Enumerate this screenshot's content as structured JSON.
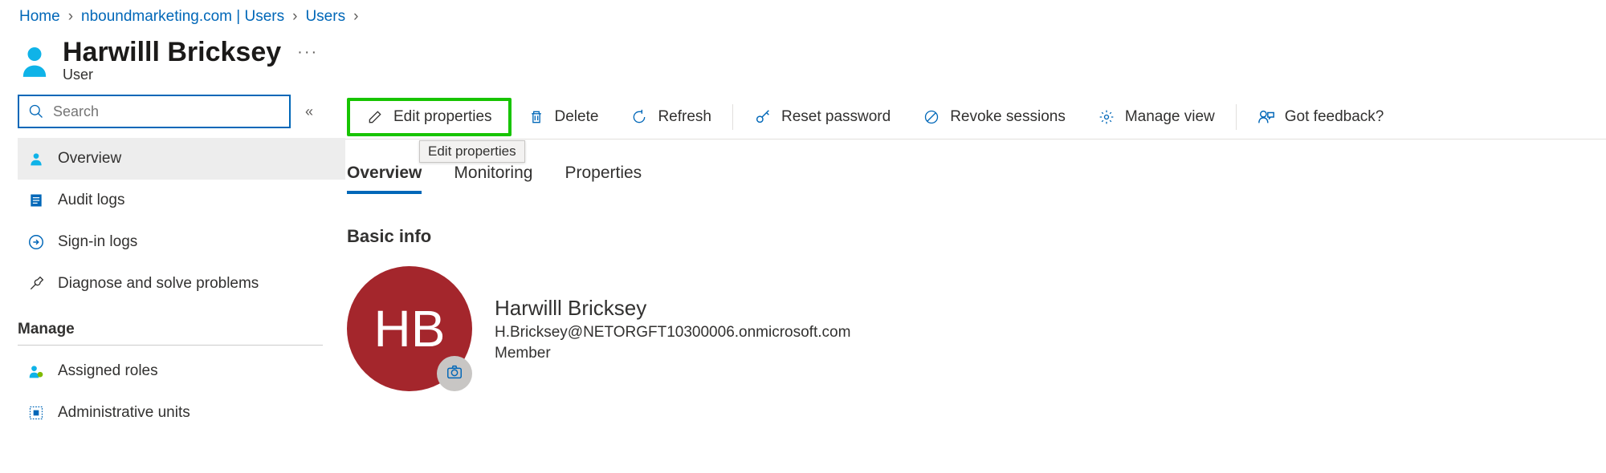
{
  "breadcrumb": {
    "items": [
      {
        "label": "Home"
      },
      {
        "label": "nboundmarketing.com | Users"
      },
      {
        "label": "Users"
      }
    ]
  },
  "header": {
    "title": "Harwilll Bricksey",
    "subtitle": "User",
    "more": "···"
  },
  "search": {
    "placeholder": "Search"
  },
  "collapse_glyph": "«",
  "sidebar": {
    "items": [
      {
        "label": "Overview"
      },
      {
        "label": "Audit logs"
      },
      {
        "label": "Sign-in logs"
      },
      {
        "label": "Diagnose and solve problems"
      }
    ],
    "manage_header": "Manage",
    "manage_items": [
      {
        "label": "Assigned roles"
      },
      {
        "label": "Administrative units"
      }
    ]
  },
  "toolbar": {
    "edit": "Edit properties",
    "delete": "Delete",
    "refresh": "Refresh",
    "reset_password": "Reset password",
    "revoke_sessions": "Revoke sessions",
    "manage_view": "Manage view",
    "feedback": "Got feedback?",
    "tooltip": "Edit properties"
  },
  "tabs": [
    {
      "label": "Overview",
      "active": true
    },
    {
      "label": "Monitoring"
    },
    {
      "label": "Properties"
    }
  ],
  "section_basic_info": "Basic info",
  "user": {
    "initials": "HB",
    "name": "Harwilll Bricksey",
    "email": "H.Bricksey@NETORGFT10300006.onmicrosoft.com",
    "role": "Member"
  }
}
